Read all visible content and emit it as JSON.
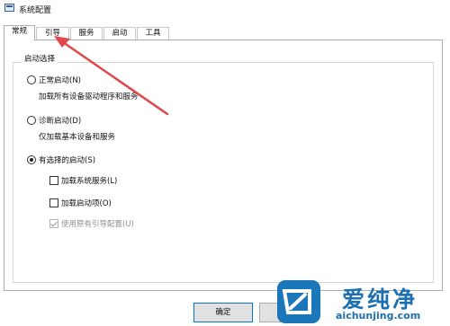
{
  "window": {
    "title": "系统配置",
    "icon": "msconfig-icon"
  },
  "tabs": [
    {
      "label": "常规",
      "active": true
    },
    {
      "label": "引导",
      "active": false
    },
    {
      "label": "服务",
      "active": false
    },
    {
      "label": "启动",
      "active": false
    },
    {
      "label": "工具",
      "active": false
    }
  ],
  "startup_selection": {
    "group_title": "启动选择",
    "normal": {
      "label": "正常启动(N)",
      "description": "加载所有设备驱动程序和服务",
      "selected": false
    },
    "diagnostic": {
      "label": "诊断启动(D)",
      "description": "仅加载基本设备和服务",
      "selected": false
    },
    "selective": {
      "label": "有选择的启动(S)",
      "selected": true,
      "options": [
        {
          "label": "加载系统服务(L)",
          "checked": false,
          "enabled": true
        },
        {
          "label": "加载启动项(O)",
          "checked": false,
          "enabled": true
        },
        {
          "label": "使用原有引导配置(U)",
          "checked": true,
          "enabled": false
        }
      ]
    }
  },
  "buttons": {
    "ok": "确定"
  },
  "annotation": {
    "type": "arrow",
    "color": "#e0474c",
    "points_to": "引导"
  },
  "watermark": {
    "brand": "爱纯净",
    "url": "aichunjing.com",
    "color": "#1c6fb0"
  }
}
